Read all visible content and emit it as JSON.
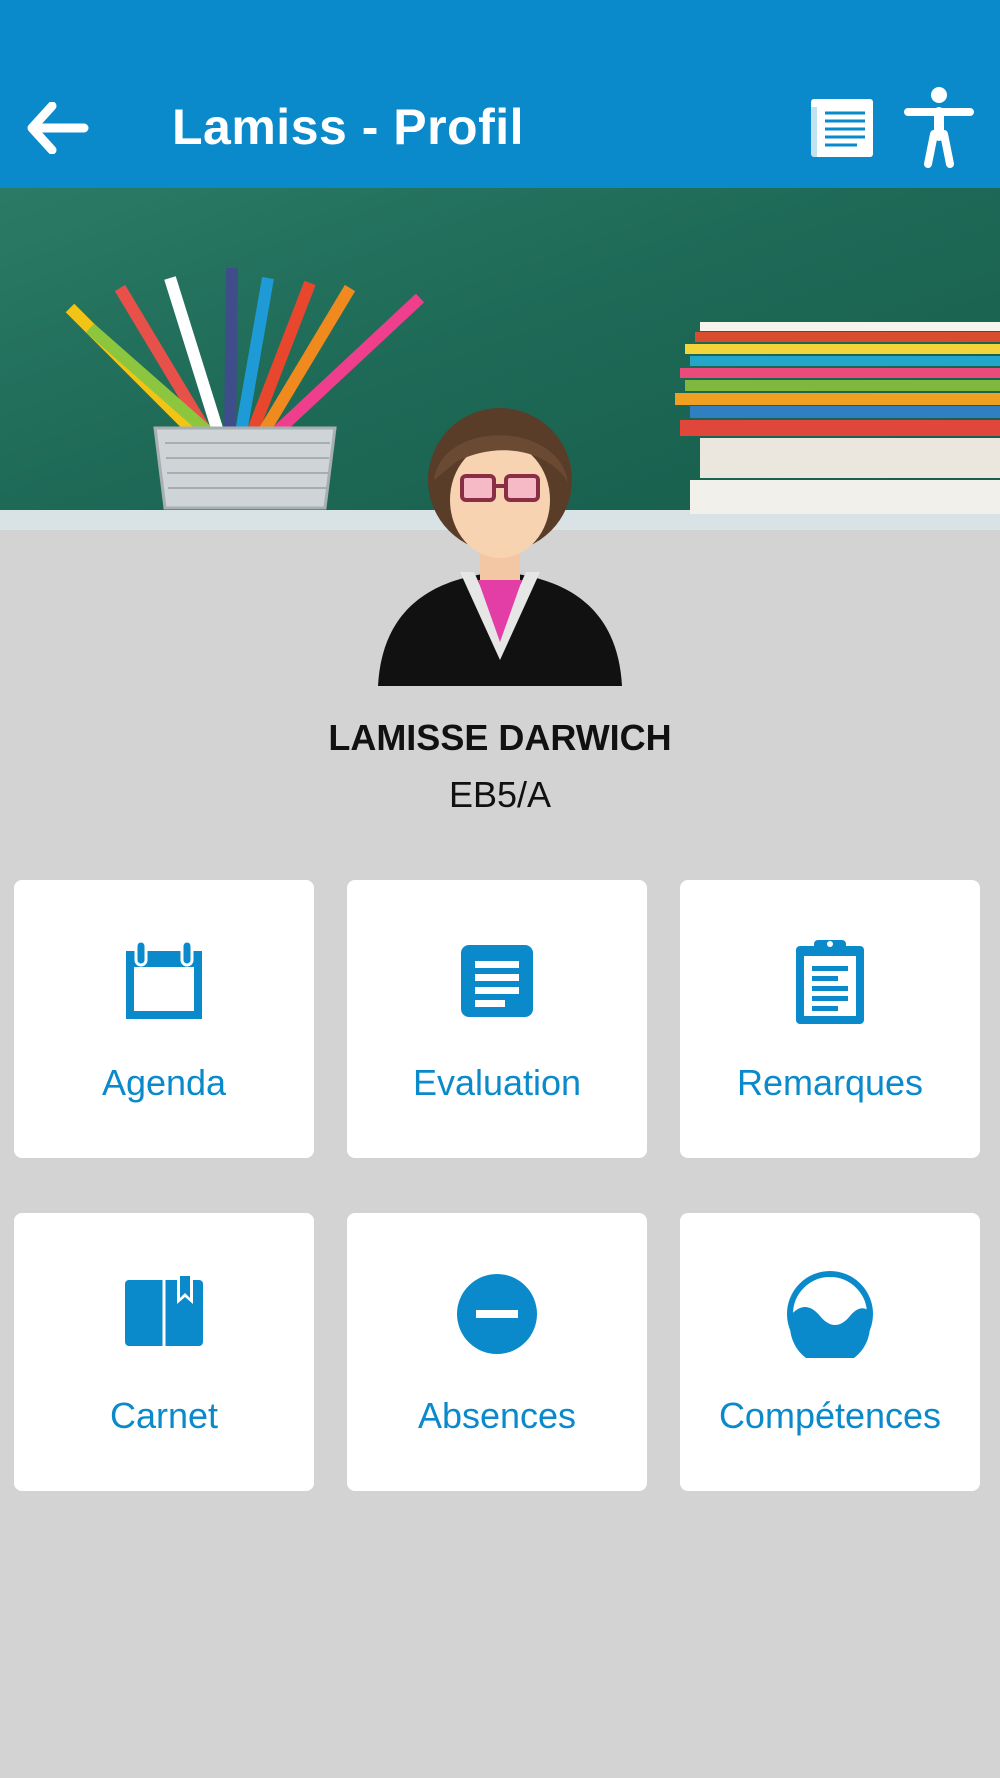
{
  "header": {
    "title": "Lamiss - Profil",
    "back_icon": "arrow-left-icon",
    "news_icon": "newspaper-icon",
    "accessibility_icon": "accessibility-icon"
  },
  "profile": {
    "name": "LAMISSE DARWICH",
    "class": "EB5/A"
  },
  "tiles": [
    {
      "label": "Agenda",
      "icon": "calendar-icon"
    },
    {
      "label": "Evaluation",
      "icon": "document-icon"
    },
    {
      "label": "Remarques",
      "icon": "clipboard-icon"
    },
    {
      "label": "Carnet",
      "icon": "book-icon"
    },
    {
      "label": "Absences",
      "icon": "minus-circle-icon"
    },
    {
      "label": "Compétences",
      "icon": "wave-circle-icon"
    }
  ],
  "colors": {
    "primary": "#0a8acb",
    "background": "#d3d3d3",
    "tile": "#ffffff"
  }
}
